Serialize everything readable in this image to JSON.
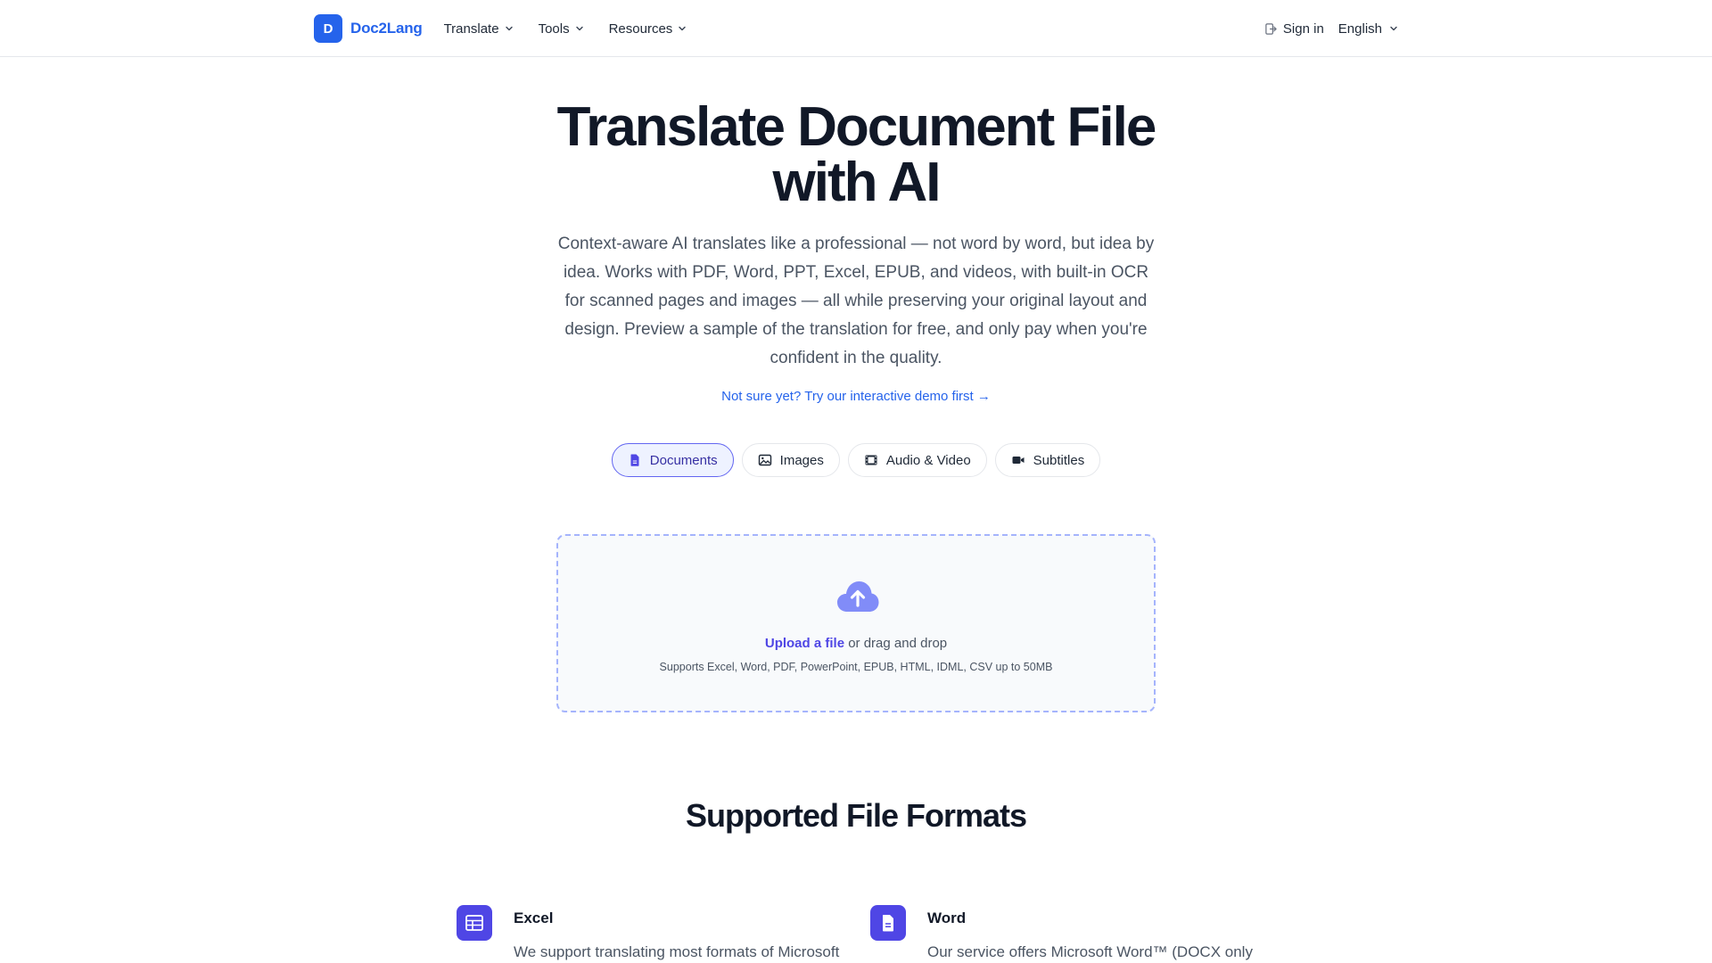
{
  "header": {
    "brand_initial": "D",
    "brand_name": "Doc2Lang",
    "nav": [
      {
        "label": "Translate"
      },
      {
        "label": "Tools"
      },
      {
        "label": "Resources"
      }
    ],
    "sign_in": "Sign in",
    "language": "English"
  },
  "hero": {
    "title_line1": "Translate Document File",
    "title_line2": "with AI",
    "description": "Context-aware AI translates like a professional — not word by word, but idea by idea. Works with PDF, Word, PPT, Excel, EPUB, and videos, with built-in OCR for scanned pages and images — all while preserving your original layout and design. Preview a sample of the translation for free, and only pay when you're confident in the quality.",
    "demo_link": "Not sure yet? Try our interactive demo first →"
  },
  "tabs": [
    {
      "label": "Documents",
      "icon": "document-icon",
      "active": true
    },
    {
      "label": "Images",
      "icon": "image-icon",
      "active": false
    },
    {
      "label": "Audio & Video",
      "icon": "film-icon",
      "active": false
    },
    {
      "label": "Subtitles",
      "icon": "video-camera-icon",
      "active": false
    }
  ],
  "upload": {
    "link_text": "Upload a file",
    "rest_text": " or drag and drop",
    "supports": "Supports Excel, Word, PDF, PowerPoint, EPUB, HTML, IDML, CSV up to 50MB"
  },
  "formats": {
    "title": "Supported File Formats",
    "items": [
      {
        "name": "Excel",
        "icon": "table-icon",
        "description": "We support translating most formats of Microsoft"
      },
      {
        "name": "Word",
        "icon": "document-icon",
        "description": "Our service offers Microsoft Word™ (DOCX only"
      }
    ]
  },
  "colors": {
    "brand": "#2563eb",
    "accent": "#4f46e5",
    "active_tab_bg": "#eef2ff",
    "upload_border": "#a5b4fc"
  }
}
